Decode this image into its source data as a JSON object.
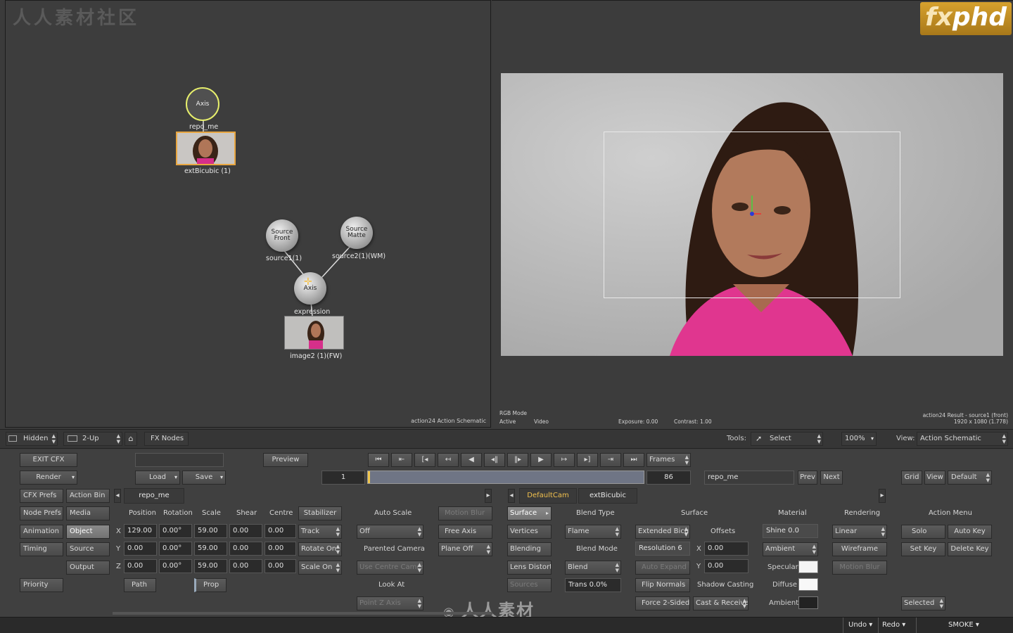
{
  "watermark": {
    "top_left": "人人素材社区",
    "bottom": "人人素材"
  },
  "logo": {
    "prefix": "fx",
    "suffix": "phd"
  },
  "schematic": {
    "caption": "action24 Action Schematic",
    "nodes": {
      "axis_top": "Axis",
      "axis_top_label": "repo_me",
      "ext_label": "extBicubic (1)",
      "source_front": "Source\nFront",
      "source_front_label": "source1(1)",
      "source_matte": "Source\nMatte",
      "source_matte_label": "source2(1)(WM)",
      "axis_mid": "Axis",
      "axis_mid_label": "expression",
      "image_label": "image2 (1)(FW)"
    }
  },
  "viewer": {
    "rgb_mode": "RGB Mode",
    "active": "Active",
    "video": "Video",
    "exposure": "Exposure: 0.00",
    "contrast": "Contrast: 1.00",
    "result_line1": "action24 Result - source1 (front)",
    "result_line2": "1920 x 1080 (1.778)"
  },
  "toolstrip": {
    "hidden": "Hidden",
    "layout": "2-Up",
    "fx_nodes": "FX Nodes",
    "tools_label": "Tools:",
    "tool_select": "Select",
    "zoom": "100%",
    "view_label": "View:",
    "view_value": "Action Schematic"
  },
  "transport": {
    "exit": "EXIT CFX",
    "render": "Render",
    "load": "Load",
    "save": "Save",
    "preview": "Preview",
    "frames": "Frames",
    "frame_start": "1",
    "frame_end": "86",
    "node_name": "repo_me",
    "prev": "Prev",
    "next": "Next",
    "grid": "Grid",
    "view": "View",
    "default": "Default"
  },
  "left_menu": {
    "cfx_prefs": "CFX Prefs",
    "action_bin": "Action Bin",
    "node_prefs": "Node Prefs",
    "media": "Media",
    "animation": "Animation",
    "object": "Object",
    "timing": "Timing",
    "source": "Source",
    "output": "Output",
    "priority": "Priority"
  },
  "object_panel": {
    "tab_name": "repo_me",
    "headers": {
      "position": "Position",
      "rotation": "Rotation",
      "scale": "Scale",
      "shear": "Shear",
      "centre": "Centre"
    },
    "stabilizer": "Stabilizer",
    "axes": [
      "X",
      "Y",
      "Z"
    ],
    "rows": [
      {
        "position": "129.00",
        "rotation": "0.00°",
        "scale": "59.00",
        "shear": "0.00",
        "centre": "0.00",
        "toggle": "Track"
      },
      {
        "position": "0.00",
        "rotation": "0.00°",
        "scale": "59.00",
        "shear": "0.00",
        "centre": "0.00",
        "toggle": "Rotate On"
      },
      {
        "position": "0.00",
        "rotation": "0.00°",
        "scale": "59.00",
        "shear": "0.00",
        "centre": "0.00",
        "toggle": "Scale On"
      }
    ],
    "path": "Path",
    "prop": "Prop"
  },
  "camera_panel": {
    "auto_scale": "Auto Scale",
    "auto_scale_value": "Off",
    "parented_camera": "Parented Camera",
    "use_centre_camera": "Use Centre Camer",
    "look_at": "Look At",
    "point_z_axis": "Point Z Axis",
    "motion_blur": "Motion Blur",
    "free_axis": "Free Axis",
    "plane_off": "Plane Off"
  },
  "surface_panel": {
    "tab_defaultcam": "DefaultCam",
    "tab_extbicubic": "extBicubic",
    "surface": "Surface",
    "vertices": "Vertices",
    "blending": "Blending",
    "lens_distort": "Lens Distort",
    "sources": "Sources",
    "blend_type": "Blend Type",
    "blend_type_value": "Flame",
    "blend_mode": "Blend Mode",
    "blend_mode_value": "Blend",
    "trans": "Trans 0.0%",
    "surface_hdr": "Surface",
    "extended_bicubic": "Extended Bicubi",
    "offsets": "Offsets",
    "resolution": "Resolution 6",
    "auto_expand": "Auto Expand",
    "offset_x_label": "X",
    "offset_x": "0.00",
    "offset_y_label": "Y",
    "offset_y": "0.00",
    "flip_normals": "Flip Normals",
    "shadow_casting": "Shadow Casting",
    "force_2_sided": "Force 2-Sided",
    "cast_receive": "Cast & Receive"
  },
  "material_panel": {
    "material": "Material",
    "shine": "Shine 0.0",
    "ambient_btn": "Ambient",
    "specular": "Specular",
    "diffuse": "Diffuse",
    "ambient": "Ambient",
    "colors": {
      "specular": "#f4f4f4",
      "diffuse": "#f8f8f8",
      "ambient": "#222222"
    }
  },
  "rendering_panel": {
    "rendering": "Rendering",
    "linear": "Linear",
    "wireframe": "Wireframe",
    "motion_blur": "Motion Blur"
  },
  "action_menu": {
    "title": "Action Menu",
    "solo": "Solo",
    "auto_key": "Auto Key",
    "set_key": "Set Key",
    "delete_key": "Delete Key",
    "selected": "Selected"
  },
  "statusbar": {
    "undo": "Undo",
    "redo": "Redo",
    "app": "SMOKE"
  }
}
